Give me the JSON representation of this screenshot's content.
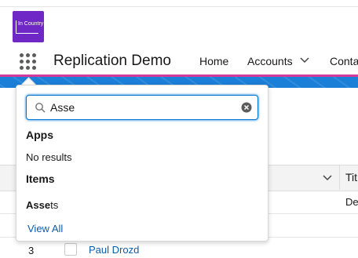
{
  "logo": {
    "text": "In Country"
  },
  "header": {
    "app_name": "Replication Demo",
    "nav": [
      {
        "label": "Home"
      },
      {
        "label": "Accounts"
      },
      {
        "label": "Conta"
      }
    ]
  },
  "search": {
    "value": "Asse"
  },
  "dropdown": {
    "apps_heading": "Apps",
    "apps_empty": "No results",
    "items_heading": "Items",
    "item_match": "Asse",
    "item_rest": "ts",
    "view_all": "View All"
  },
  "table": {
    "column_title": "Tit",
    "cell_title": "De",
    "row3": {
      "number": "3",
      "name": "Paul Drozd"
    }
  },
  "colors": {
    "accent": "#0176d3",
    "brand": "#6f27c5",
    "band": "#1b7fd8",
    "stripe": "#d33a9a"
  }
}
